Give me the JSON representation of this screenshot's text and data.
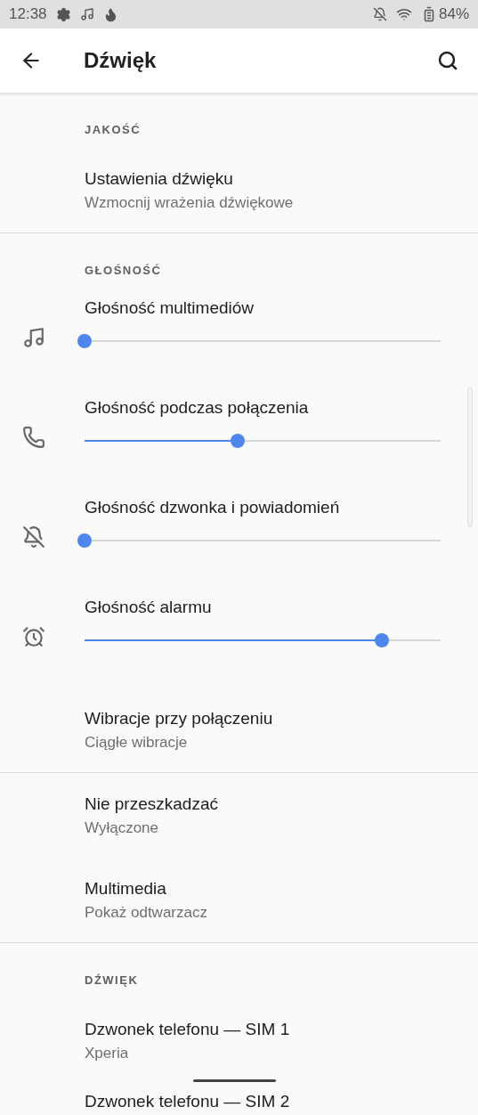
{
  "status_bar": {
    "time": "12:38",
    "battery": "84%"
  },
  "app_bar": {
    "title": "Dźwięk"
  },
  "sections": [
    {
      "header": "JAKOŚĆ",
      "items": [
        {
          "kind": "text",
          "title": "Ustawienia dźwięku",
          "subtitle": "Wzmocnij wrażenia dźwiękowe"
        }
      ]
    },
    {
      "header": "GŁOŚNOŚĆ",
      "items": [
        {
          "kind": "slider",
          "title": "Głośność multimediów",
          "level": 0
        },
        {
          "kind": "slider",
          "title": "Głośność podczas połączenia",
          "level": 0.43
        },
        {
          "kind": "slider",
          "title": "Głośność dzwonka i powiadomień",
          "level": 0
        },
        {
          "kind": "slider",
          "title": "Głośność alarmu",
          "level": 0.835
        },
        {
          "kind": "text",
          "title": "Wibracje przy połączeniu",
          "subtitle": "Ciągłe wibracje"
        }
      ]
    },
    {
      "items": [
        {
          "kind": "text",
          "title": "Nie przeszkadzać",
          "subtitle": "Wyłączone"
        },
        {
          "kind": "text",
          "title": "Multimedia",
          "subtitle": "Pokaż odtwarzacz"
        }
      ]
    },
    {
      "header": "DŹWIĘK",
      "items": [
        {
          "kind": "text",
          "title": "Dzwonek telefonu — SIM 1",
          "subtitle": "Xperia"
        },
        {
          "kind": "text",
          "title": "Dzwonek telefonu — SIM 2"
        }
      ]
    }
  ]
}
